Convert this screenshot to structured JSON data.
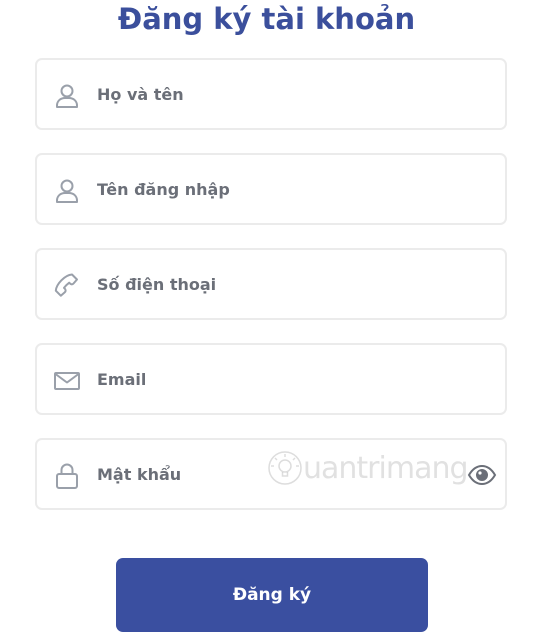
{
  "form": {
    "title": "Đăng ký tài khoản",
    "fields": [
      {
        "icon": "user-icon",
        "placeholder": "Họ và tên",
        "value": ""
      },
      {
        "icon": "user-icon",
        "placeholder": "Tên đăng nhập",
        "value": ""
      },
      {
        "icon": "phone-icon",
        "placeholder": "Số điện thoại",
        "value": ""
      },
      {
        "icon": "mail-icon",
        "placeholder": "Email",
        "value": ""
      },
      {
        "icon": "lock-icon",
        "placeholder": "Mật khẩu",
        "value": "",
        "toggle_icon": "eye-icon"
      }
    ],
    "submit_label": "Đăng ký"
  },
  "watermark": {
    "text": "uantrimang"
  },
  "colors": {
    "accent": "#3a4fa0",
    "title": "#3b4f9c",
    "icon": "#9aa0aa",
    "field_border": "#ebebeb",
    "placeholder": "#6b6f78"
  }
}
